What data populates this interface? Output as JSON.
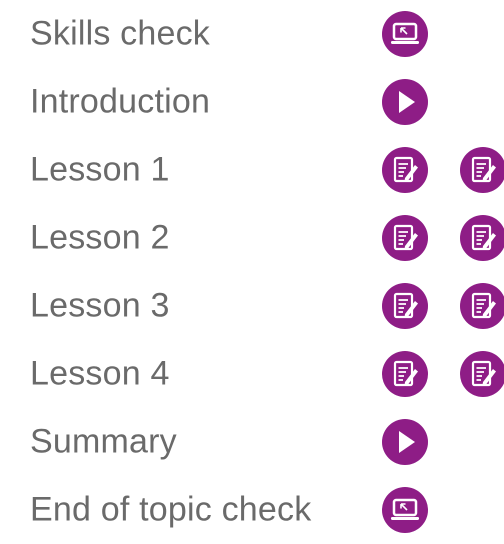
{
  "brand_color": "#8e1d86",
  "text_color": "#6a6a6a",
  "items": [
    {
      "label": "Skills check",
      "icons": [
        "laptop-icon"
      ]
    },
    {
      "label": "Introduction",
      "icons": [
        "play-icon"
      ]
    },
    {
      "label": "Lesson 1",
      "icons": [
        "worksheet-icon",
        "worksheet-icon"
      ]
    },
    {
      "label": "Lesson 2",
      "icons": [
        "worksheet-icon",
        "worksheet-icon"
      ]
    },
    {
      "label": "Lesson 3",
      "icons": [
        "worksheet-icon",
        "worksheet-icon"
      ]
    },
    {
      "label": "Lesson 4",
      "icons": [
        "worksheet-icon",
        "worksheet-icon"
      ]
    },
    {
      "label": "Summary",
      "icons": [
        "play-icon"
      ]
    },
    {
      "label": "End of topic check",
      "icons": [
        "laptop-icon"
      ]
    }
  ]
}
